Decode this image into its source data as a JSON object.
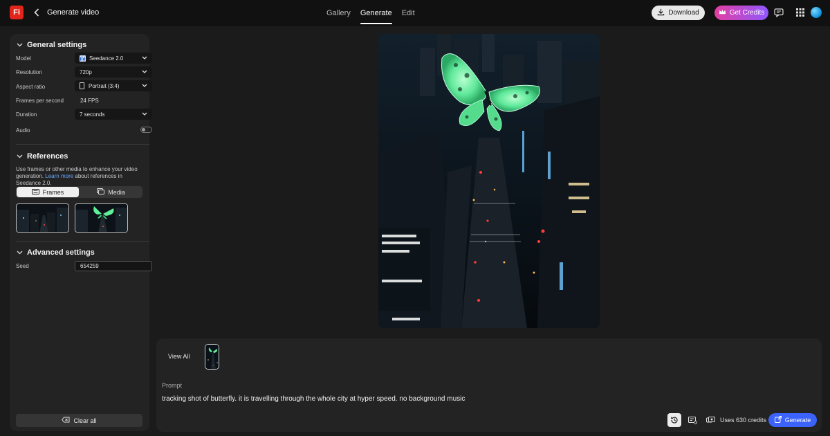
{
  "app": {
    "logo_text": "Fi",
    "title": "Generate video"
  },
  "nav": {
    "tabs": [
      {
        "label": "Gallery"
      },
      {
        "label": "Generate",
        "active": true
      },
      {
        "label": "Edit"
      }
    ]
  },
  "header": {
    "download_label": "Download",
    "credits_label": "Get Credits"
  },
  "sidebar": {
    "general": {
      "title": "General settings",
      "model_label": "Model",
      "model_value": "Seedance 2.0",
      "resolution_label": "Resolution",
      "resolution_value": "720p",
      "aspect_label": "Aspect ratio",
      "aspect_value": "Portrait (3:4)",
      "fps_label": "Frames per second",
      "fps_value": "24 FPS",
      "duration_label": "Duration",
      "duration_value": "7 seconds",
      "audio_label": "Audio",
      "audio_on": false
    },
    "references": {
      "title": "References",
      "desc_before": "Use frames or other media to enhance your video generation. ",
      "desc_link": "Learn more",
      "desc_after": " about references in Seedance 2.0.",
      "frames_label": "Frames",
      "media_label": "Media",
      "active_tab": "Frames"
    },
    "advanced": {
      "title": "Advanced settings",
      "seed_label": "Seed",
      "seed_value": "654259"
    },
    "clear_label": "Clear all"
  },
  "bottom": {
    "view_all_label": "View All",
    "prompt_label": "Prompt",
    "prompt_text": "tracking shot of butterfly. it is travelling through the whole city at hyper speed. no background music",
    "uses_credits": "Uses 630 credits",
    "generate_label": "Generate"
  },
  "colors": {
    "accent": "#3b63fb",
    "brand": "#e1251b",
    "credits_gradient_start": "#e23fa1",
    "credits_gradient_end": "#8f58ff"
  },
  "icons": [
    "back-arrow-icon",
    "download-icon",
    "crown-icon",
    "chat-icon",
    "apps-grid-icon",
    "chevron-down-icon",
    "portrait-icon",
    "frames-icon",
    "media-icon",
    "clear-icon",
    "history-icon",
    "settings-icon",
    "credits-icon",
    "generate-icon"
  ]
}
